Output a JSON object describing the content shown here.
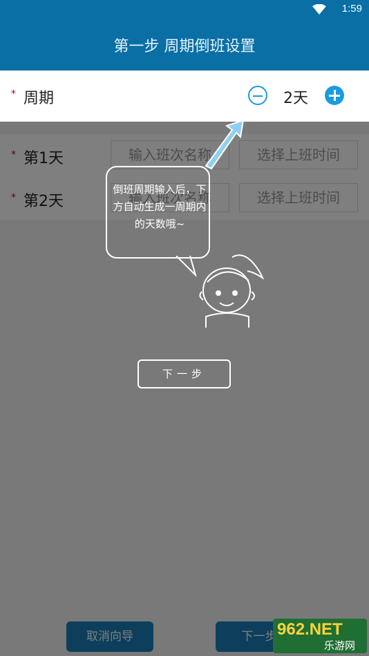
{
  "status": {
    "time": "1:59"
  },
  "header": {
    "title": "第一步 周期倒班设置"
  },
  "period": {
    "star": "*",
    "label": "周期",
    "value": "2天"
  },
  "days": [
    {
      "star": "*",
      "label": "第1天",
      "name_placeholder": "输入班次名称",
      "time_placeholder": "选择上班时间"
    },
    {
      "star": "*",
      "label": "第2天",
      "name_placeholder": "输入班次名称",
      "time_placeholder": "选择上班时间"
    }
  ],
  "tutorial": {
    "bubble_text": "倒班周期输入后，下方自动生成一周期内的天数哦~",
    "next_label": "下一步"
  },
  "bottom": {
    "cancel_label": "取消向导",
    "next_label": "下一步"
  },
  "watermark": {
    "line1": "962.NET",
    "line2": "乐游网"
  },
  "colors": {
    "header": "#0a6fa5",
    "accent": "#1a9be0",
    "overlay": "rgba(0,0,0,0.5)"
  }
}
